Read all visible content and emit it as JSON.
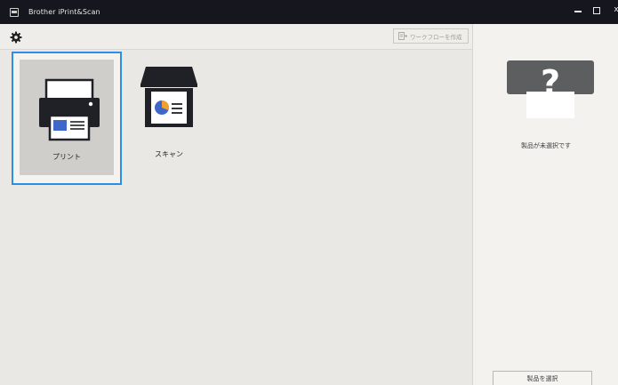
{
  "window": {
    "title": "Brother iPrint&Scan",
    "close_glyph": "x"
  },
  "toolbar": {
    "settings_icon": "gear-icon",
    "create_workflow_label": "ワークフローを作成"
  },
  "tiles": [
    {
      "label": "プリント",
      "icon": "printer-icon",
      "selected": true
    },
    {
      "label": "スキャン",
      "icon": "scanner-icon",
      "selected": false
    }
  ],
  "product_panel": {
    "status_text": "製品が未選択です",
    "select_button_label": "製品を選択",
    "icon": "unknown-device-icon"
  },
  "colors": {
    "title_bar": "#16161e",
    "selection_border": "#2b8fe6",
    "printer_body": "#1f2126",
    "paper_blue": "#3f66c9",
    "scan_orange": "#f0a12b"
  }
}
